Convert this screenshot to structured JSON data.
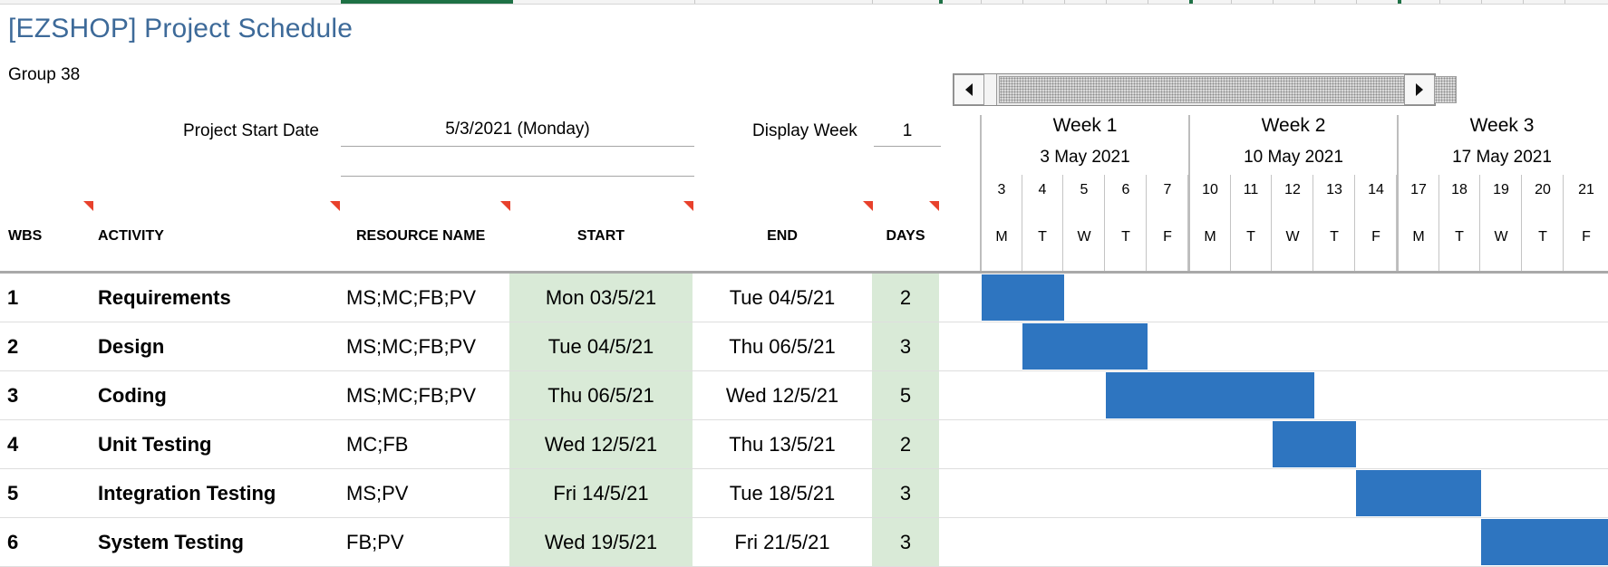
{
  "title": "[EZSHOP] Project Schedule",
  "group": "Group 38",
  "project_start": {
    "label": "Project Start Date",
    "value": "5/3/2021 (Monday)"
  },
  "display_week": {
    "label": "Display Week",
    "value": "1"
  },
  "headers": {
    "wbs": "WBS",
    "activity": "ACTIVITY",
    "resource": "RESOURCE NAME",
    "start": "START",
    "end": "END",
    "days": "DAYS"
  },
  "weeks": [
    {
      "name": "Week 1",
      "date": "3 May 2021"
    },
    {
      "name": "Week 2",
      "date": "10 May 2021"
    },
    {
      "name": "Week 3",
      "date": "17 May 2021"
    }
  ],
  "days": [
    {
      "num": "3",
      "letter": "M"
    },
    {
      "num": "4",
      "letter": "T"
    },
    {
      "num": "5",
      "letter": "W"
    },
    {
      "num": "6",
      "letter": "T"
    },
    {
      "num": "7",
      "letter": "F"
    },
    {
      "num": "10",
      "letter": "M"
    },
    {
      "num": "11",
      "letter": "T"
    },
    {
      "num": "12",
      "letter": "W"
    },
    {
      "num": "13",
      "letter": "T"
    },
    {
      "num": "14",
      "letter": "F"
    },
    {
      "num": "17",
      "letter": "M"
    },
    {
      "num": "18",
      "letter": "T"
    },
    {
      "num": "19",
      "letter": "W"
    },
    {
      "num": "20",
      "letter": "T"
    },
    {
      "num": "21",
      "letter": "F"
    }
  ],
  "tasks": [
    {
      "wbs": "1",
      "activity": "Requirements",
      "resource": "MS;MC;FB;PV",
      "start": "Mon 03/5/21",
      "end": "Tue 04/5/21",
      "days": "2",
      "bar_start_day": 0,
      "bar_len_days": 2
    },
    {
      "wbs": "2",
      "activity": "Design",
      "resource": "MS;MC;FB;PV",
      "start": "Tue 04/5/21",
      "end": "Thu 06/5/21",
      "days": "3",
      "bar_start_day": 1,
      "bar_len_days": 3
    },
    {
      "wbs": "3",
      "activity": "Coding",
      "resource": "MS;MC;FB;PV",
      "start": "Thu 06/5/21",
      "end": "Wed 12/5/21",
      "days": "5",
      "bar_start_day": 3,
      "bar_len_days": 5
    },
    {
      "wbs": "4",
      "activity": "Unit Testing",
      "resource": "MC;FB",
      "start": "Wed 12/5/21",
      "end": "Thu 13/5/21",
      "days": "2",
      "bar_start_day": 7,
      "bar_len_days": 2
    },
    {
      "wbs": "5",
      "activity": "Integration Testing",
      "resource": "MS;PV",
      "start": "Fri 14/5/21",
      "end": "Tue 18/5/21",
      "days": "3",
      "bar_start_day": 9,
      "bar_len_days": 3
    },
    {
      "wbs": "6",
      "activity": "System Testing",
      "resource": "FB;PV",
      "start": "Wed 19/5/21",
      "end": "Fri 21/5/21",
      "days": "3",
      "bar_start_day": 12,
      "bar_len_days": 3
    }
  ],
  "colors": {
    "title": "#3d6a99",
    "bar": "#2e75c0",
    "start_fill": "#d9ead7",
    "flag": "#e8412c"
  }
}
